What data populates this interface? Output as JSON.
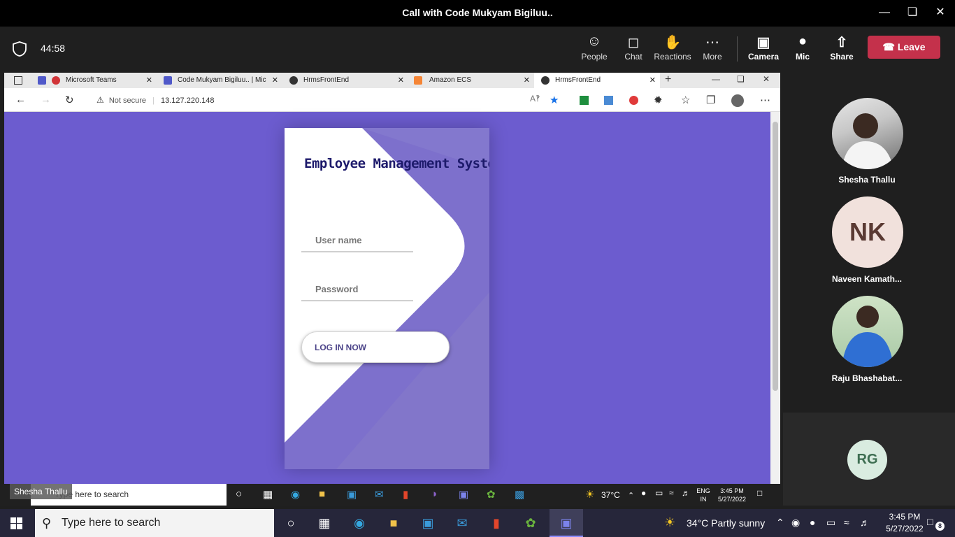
{
  "window": {
    "title": "Call with Code Mukyam Bigiluu.."
  },
  "meeting": {
    "timer": "44:58",
    "toolbar": {
      "people": "People",
      "chat": "Chat",
      "reactions": "Reactions",
      "more": "More",
      "camera": "Camera",
      "mic": "Mic",
      "share": "Share",
      "leave": "Leave"
    }
  },
  "browser": {
    "tabs": [
      {
        "title": "Microsoft Teams"
      },
      {
        "title": "Code Mukyam Bigiluu.. | Mic"
      },
      {
        "title": "HrmsFrontEnd"
      },
      {
        "title": "Amazon ECS"
      },
      {
        "title": "HrmsFrontEnd"
      }
    ],
    "security_label": "Not secure",
    "url": "13.127.220.148"
  },
  "login": {
    "title": "Employee Management System",
    "username_placeholder": "User name",
    "password_placeholder": "Password",
    "button": "LOG IN NOW"
  },
  "inner_taskbar": {
    "search": "Type here to search",
    "temperature": "37°C",
    "lang": "ENG",
    "region": "IN",
    "time": "3:45 PM",
    "date": "5/27/2022"
  },
  "presenter": "Shesha Thallu",
  "participants": [
    {
      "name": "Shesha Thallu",
      "initials": ""
    },
    {
      "name": "Naveen Kamath...",
      "initials": "NK"
    },
    {
      "name": "Raju Bhashabat...",
      "initials": ""
    },
    {
      "name": "",
      "initials": "RG"
    }
  ],
  "taskbar": {
    "search": "Type here to search",
    "weather": "34°C  Partly sunny",
    "time": "3:45 PM",
    "date": "5/27/2022",
    "notification_count": "8"
  },
  "colors": {
    "page_bg": "#6c5ccf",
    "leave": "#c4314b",
    "title_text": "#1d1a6b"
  }
}
